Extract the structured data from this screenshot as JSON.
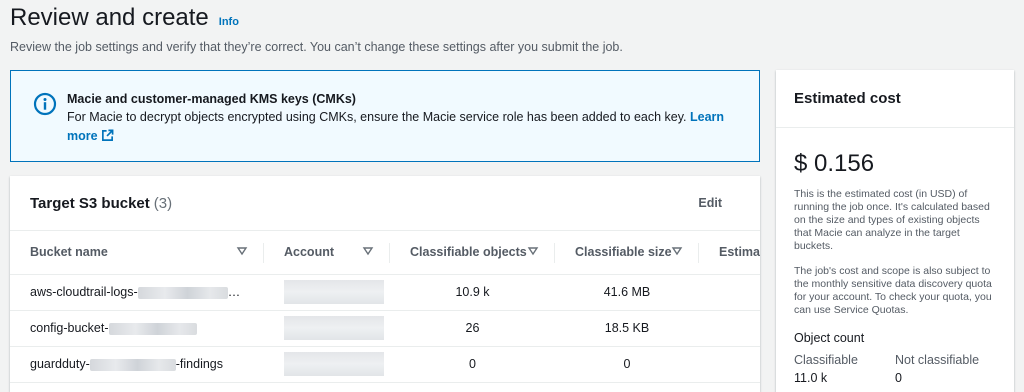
{
  "header": {
    "title": "Review and create",
    "info_label": "Info",
    "description": "Review the job settings and verify that they’re correct. You can’t change these settings after you submit the job."
  },
  "alert": {
    "icon": "info-circle-icon",
    "title": "Macie and customer-managed KMS keys (CMKs)",
    "body": "For Macie to decrypt objects encrypted using CMKs, ensure the Macie service role has been added to each key.",
    "link_label": "Learn more",
    "link_icon": "external-link-icon"
  },
  "bucket_table": {
    "title": "Target S3 bucket",
    "count": "(3)",
    "edit_label": "Edit",
    "columns": [
      "Bucket name",
      "Account",
      "Classifiable objects",
      "Classifiable size",
      "Estimated cost"
    ],
    "column_visible_label_5": "Estima",
    "rows": [
      {
        "name_prefix": "aws-cloudtrail-logs-",
        "name_suffix": "…",
        "objects": "10.9 k",
        "size": "41.6 MB"
      },
      {
        "name_prefix": "config-bucket-",
        "name_suffix": "",
        "objects": "26",
        "size": "18.5 KB"
      },
      {
        "name_prefix": "guardduty-",
        "name_suffix": "-findings",
        "objects": "0",
        "size": "0"
      }
    ]
  },
  "cost": {
    "title": "Estimated cost",
    "value": "$ 0.156",
    "note": "This is the estimated cost (in USD) of running the job once. It's calculated based on the size and types of existing objects that Macie can analyze in the target buckets.",
    "note2": "The job's cost and scope is also subject to the monthly sensitive data discovery quota for your account. To check your quota, you can use Service Quotas.",
    "object_count_title": "Object count",
    "classifiable_label": "Classifiable",
    "classifiable_value": "11.0 k",
    "not_classifiable_label": "Not classifiable",
    "not_classifiable_value": "0"
  },
  "colors": {
    "link": "#0073bb",
    "alert_bg": "#f1faff",
    "page_bg": "#f2f3f3"
  }
}
